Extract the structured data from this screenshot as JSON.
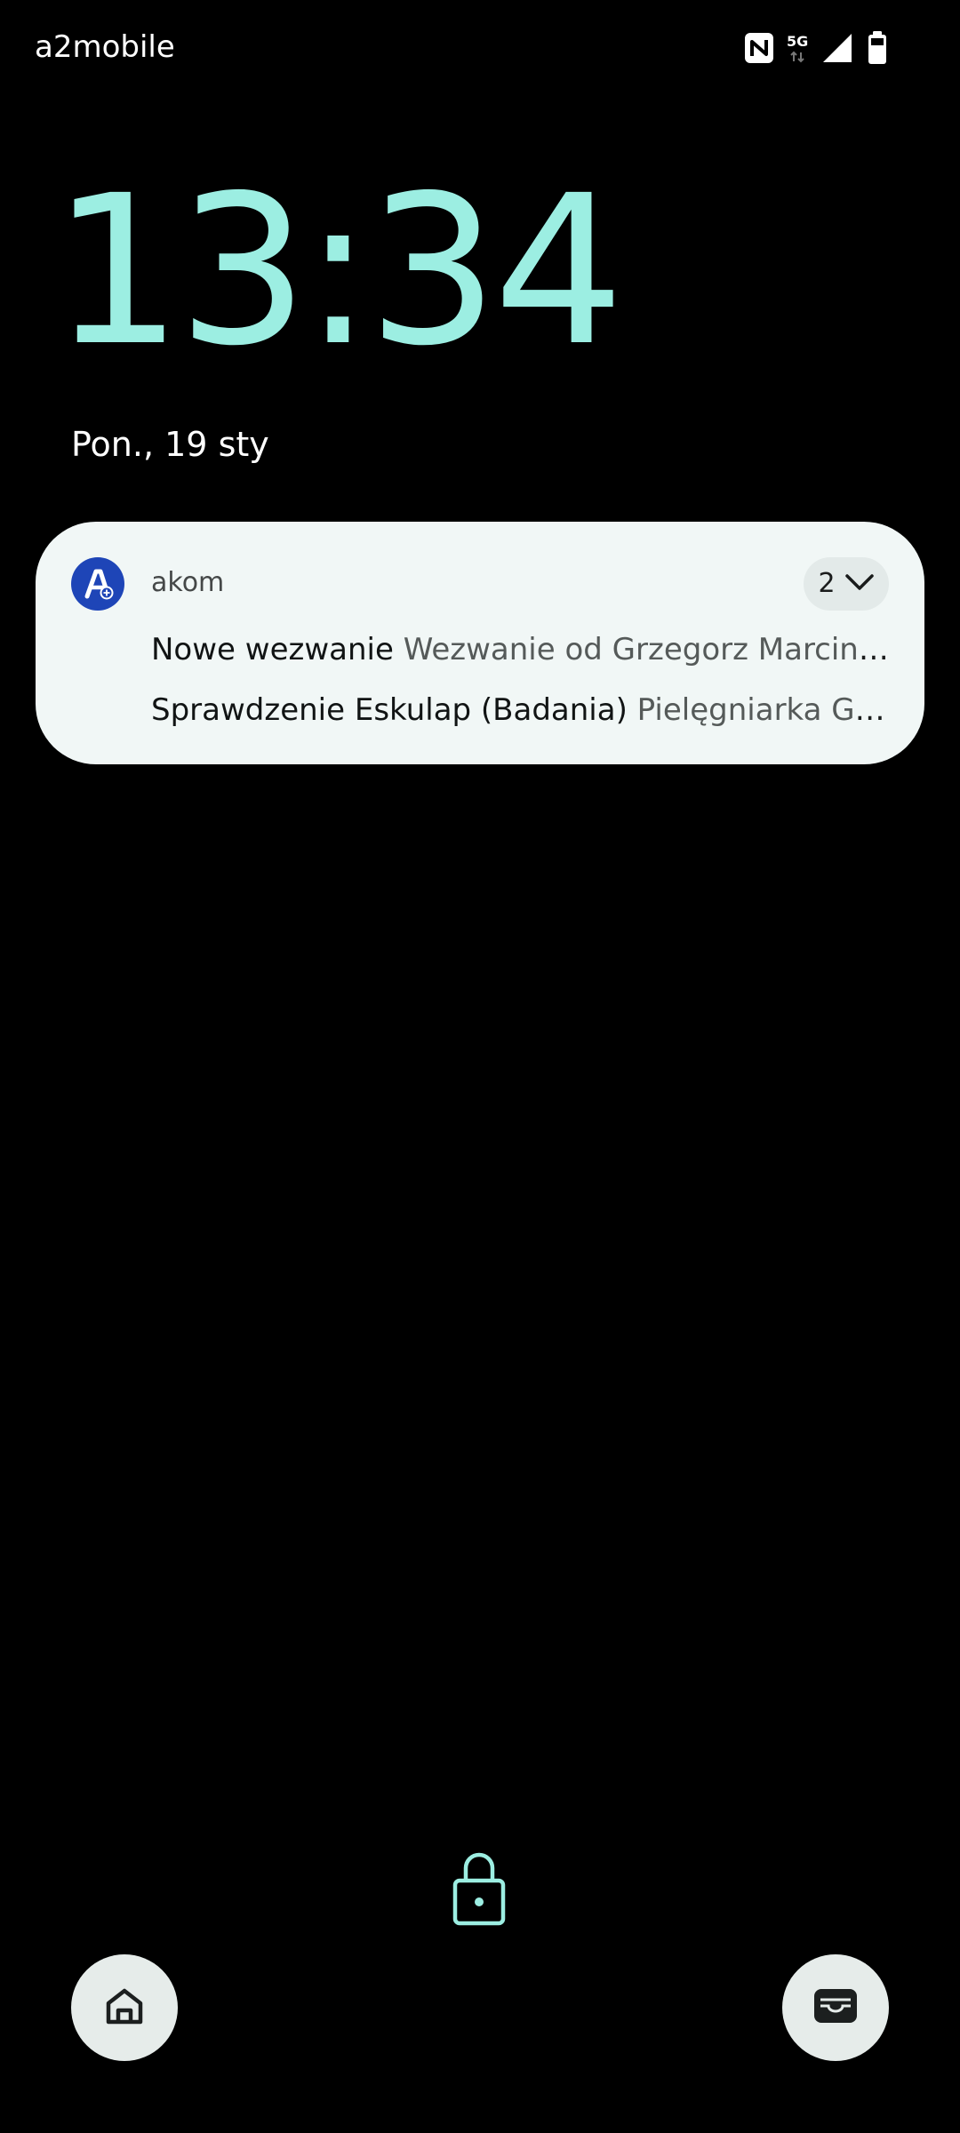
{
  "status_bar": {
    "carrier": "a2mobile",
    "network_label": "5G",
    "icons": [
      "nfc-icon",
      "5g-icon",
      "signal-icon",
      "battery-icon"
    ]
  },
  "lockscreen": {
    "time": "13:34",
    "date": "Pon., 19 sty"
  },
  "notification": {
    "app_name": "akom",
    "count": "2",
    "items": [
      {
        "title": "Nowe wezwanie",
        "text": "Wezwanie od Grzegorz Marcinkiewicz"
      },
      {
        "title": "Sprawdzenie Eskulap (Badania)",
        "text": "Pielęgniarka Grzegorz"
      }
    ]
  },
  "shortcuts": {
    "left": "home-icon",
    "right": "wallet-icon"
  },
  "colors": {
    "clock": "#9ceee2",
    "notification_bg": "#f1f7f6",
    "app_icon_bg": "#1e45b7",
    "shortcut_bg": "#e6ecea"
  }
}
